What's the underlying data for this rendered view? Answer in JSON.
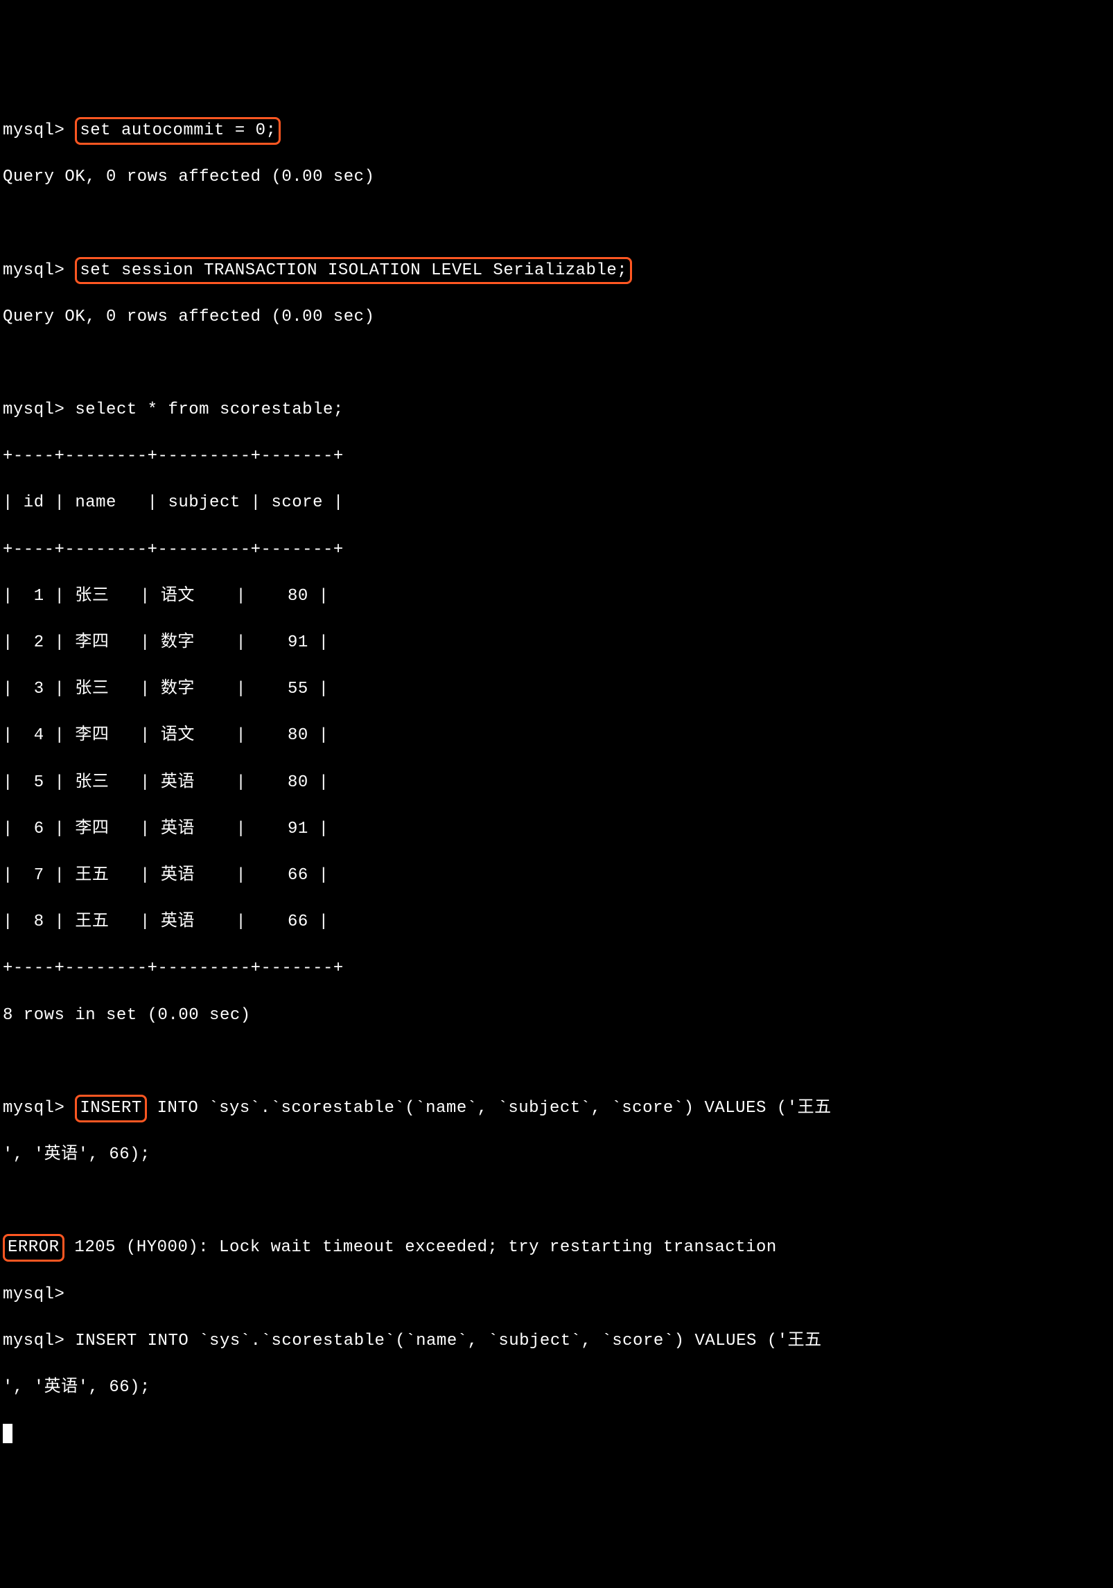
{
  "prompt": "mysql>",
  "commands": {
    "set_autocommit": "set autocommit = 0;",
    "set_isolation": "set session TRANSACTION ISOLATION LEVEL Serializable;",
    "select_all": "select * from scorestable;",
    "insert_keyword": "INSERT",
    "insert_rest_1": " INTO `sys`.`scorestable`(`name`, `subject`, `score`) VALUES ('王五",
    "insert_line2": "', '英语', 66);",
    "insert_full_1": "INSERT INTO `sys`.`scorestable`(`name`, `subject`, `score`) VALUES ('王五",
    "insert_full_2": "', '英语', 66);"
  },
  "responses": {
    "query_ok": "Query OK, 0 rows affected (0.00 sec)",
    "rows_in_set": "8 rows in set (0.00 sec)",
    "error_keyword": "ERROR",
    "error_rest": " 1205 (HY000): Lock wait timeout exceeded; try restarting transaction"
  },
  "table": {
    "border_top": "+----+--------+---------+-------+",
    "header": "| id | name   | subject | score |",
    "border_mid": "+----+--------+---------+-------+",
    "rows": [
      "|  1 | 张三   | 语文    |    80 |",
      "|  2 | 李四   | 数字    |    91 |",
      "|  3 | 张三   | 数字    |    55 |",
      "|  4 | 李四   | 语文    |    80 |",
      "|  5 | 张三   | 英语    |    80 |",
      "|  6 | 李四   | 英语    |    91 |",
      "|  7 | 王五   | 英语    |    66 |",
      "|  8 | 王五   | 英语    |    66 |"
    ],
    "border_bot": "+----+--------+---------+-------+"
  },
  "chart_data": {
    "type": "table",
    "columns": [
      "id",
      "name",
      "subject",
      "score"
    ],
    "rows": [
      {
        "id": 1,
        "name": "张三",
        "subject": "语文",
        "score": 80
      },
      {
        "id": 2,
        "name": "李四",
        "subject": "数字",
        "score": 91
      },
      {
        "id": 3,
        "name": "张三",
        "subject": "数字",
        "score": 55
      },
      {
        "id": 4,
        "name": "李四",
        "subject": "语文",
        "score": 80
      },
      {
        "id": 5,
        "name": "张三",
        "subject": "英语",
        "score": 80
      },
      {
        "id": 6,
        "name": "李四",
        "subject": "英语",
        "score": 91
      },
      {
        "id": 7,
        "name": "王五",
        "subject": "英语",
        "score": 66
      },
      {
        "id": 8,
        "name": "王五",
        "subject": "英语",
        "score": 66
      }
    ]
  }
}
